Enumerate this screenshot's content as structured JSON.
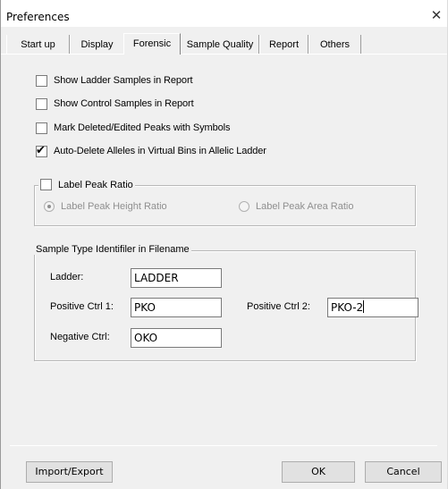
{
  "window": {
    "title": "Preferences",
    "close_glyph": "✕"
  },
  "tabs": [
    {
      "label": "Start up",
      "active": false
    },
    {
      "label": "Display",
      "active": false
    },
    {
      "label": "Forensic",
      "active": true
    },
    {
      "label": "Sample Quality",
      "active": false
    },
    {
      "label": "Report",
      "active": false
    },
    {
      "label": "Others",
      "active": false
    }
  ],
  "options": {
    "show_ladder": {
      "label": "Show Ladder Samples in Report",
      "checked": false
    },
    "show_control": {
      "label": "Show Control Samples in Report",
      "checked": false
    },
    "mark_deleted": {
      "label": "Mark Deleted/Edited Peaks with Symbols",
      "checked": false
    },
    "auto_delete": {
      "label": "Auto-Delete Alleles in Virtual Bins in Allelic Ladder",
      "checked": true
    }
  },
  "peak_ratio": {
    "label": "Label Peak Ratio",
    "checked": false,
    "height_label": "Label Peak Height Ratio",
    "area_label": "Label Peak Area Ratio",
    "selected": "height"
  },
  "sample_type": {
    "legend": "Sample Type Identifiler in Filename",
    "ladder_label": "Ladder:",
    "ladder_value": "LADDER",
    "pos1_label": "Positive Ctrl 1:",
    "pos1_value": "PKO",
    "pos2_label": "Positive Ctrl 2:",
    "pos2_value": "PKO-2",
    "neg_label": "Negative Ctrl:",
    "neg_value": "OKO"
  },
  "buttons": {
    "import_export": "Import/Export",
    "ok": "OK",
    "cancel": "Cancel"
  },
  "check_glyph": "✔"
}
